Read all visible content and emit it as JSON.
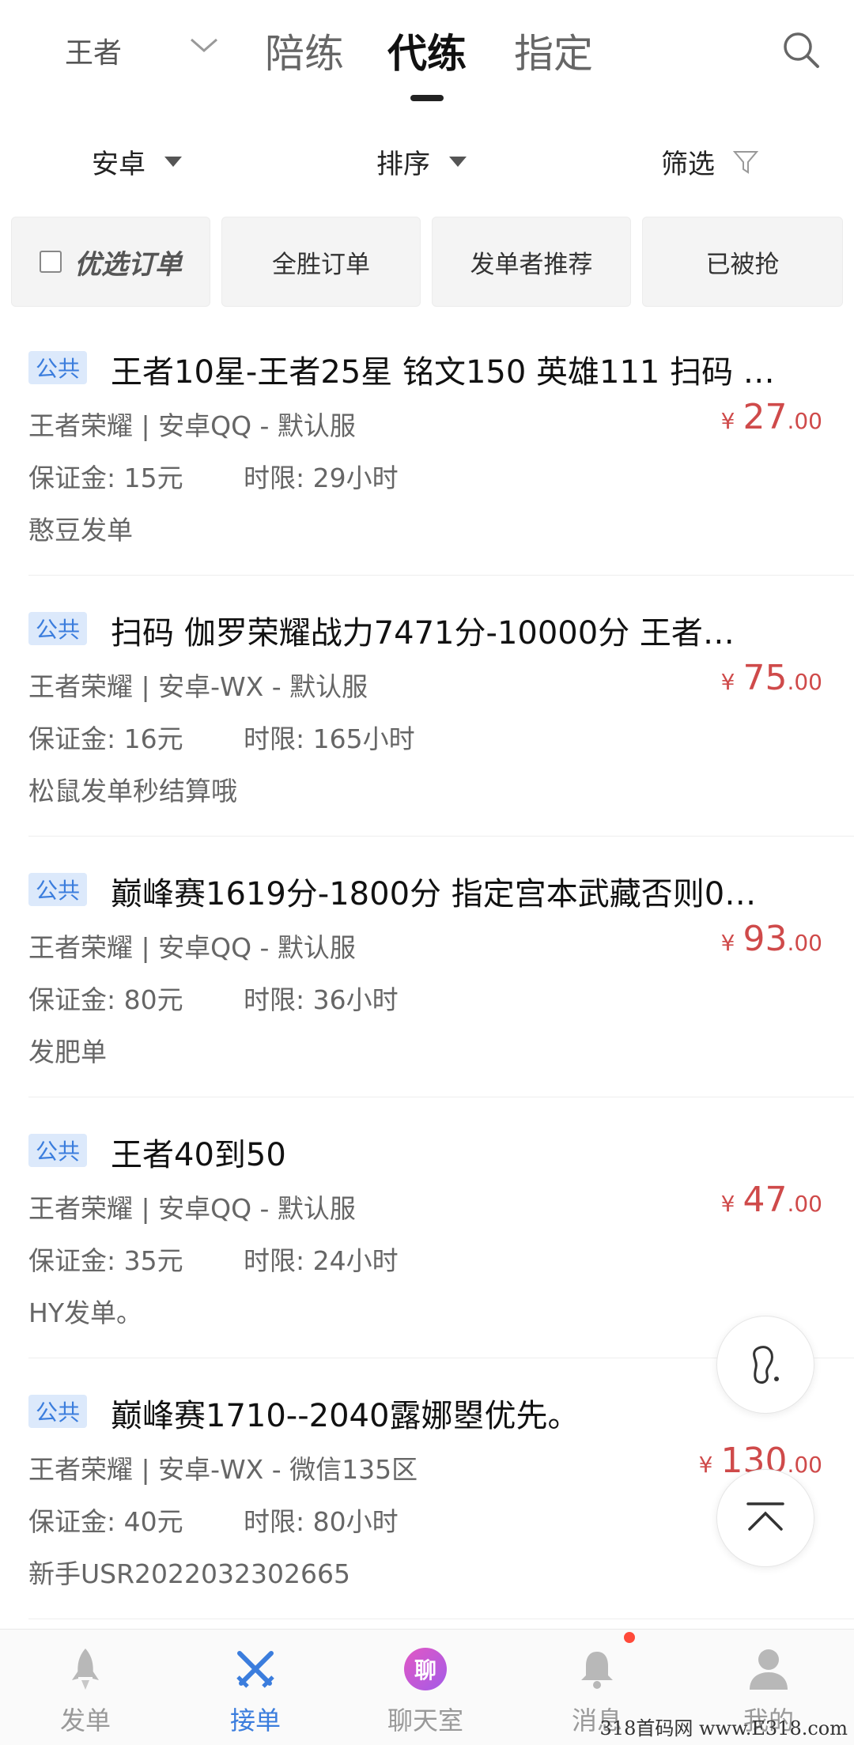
{
  "header": {
    "game": "王者",
    "tabs": [
      "陪练",
      "代练",
      "指定"
    ],
    "active_tab": 1
  },
  "filters": {
    "platform": "安卓",
    "sort": "排序",
    "filter": "筛选"
  },
  "chips": {
    "preferred": "优选订单",
    "all_win": "全胜订单",
    "recommended": "发单者推荐",
    "taken": "已被抢"
  },
  "orders": [
    {
      "badge": "公共",
      "title": "王者10星-王者25星 铭文150 英雄111 扫码 …",
      "meta": "王者荣耀 | 安卓QQ - 默认服",
      "deposit": "保证金: 15元",
      "time_limit": "时限:  29小时",
      "publisher": "憨豆发单",
      "price_symbol": "¥",
      "price_int": "27",
      "price_dec": ".00"
    },
    {
      "badge": "公共",
      "title": "扫码   伽罗荣耀战力7471分-10000分    王者…",
      "meta": "王者荣耀 | 安卓-WX - 默认服",
      "deposit": "保证金: 16元",
      "time_limit": "时限:  165小时",
      "publisher": "松鼠发单秒结算哦",
      "price_symbol": "¥",
      "price_int": "75",
      "price_dec": ".00"
    },
    {
      "badge": "公共",
      "title": "巅峰赛1619分-1800分 指定宫本武藏否则0…",
      "meta": "王者荣耀 | 安卓QQ - 默认服",
      "deposit": "保证金: 80元",
      "time_limit": "时限:  36小时",
      "publisher": "发肥单",
      "price_symbol": "¥",
      "price_int": "93",
      "price_dec": ".00"
    },
    {
      "badge": "公共",
      "title": "王者40到50",
      "meta": "王者荣耀 | 安卓QQ - 默认服",
      "deposit": "保证金: 35元",
      "time_limit": "时限:  24小时",
      "publisher": "HY发单。",
      "price_symbol": "¥",
      "price_int": "47",
      "price_dec": ".00"
    },
    {
      "badge": "公共",
      "title": "巅峰赛1710--2040露娜曌优先。",
      "meta": "王者荣耀 | 安卓-WX - 微信135区",
      "deposit": "保证金: 40元",
      "time_limit": "时限:  80小时",
      "publisher": "新手USR2022032302665",
      "price_symbol": "¥",
      "price_int": "130",
      "price_dec": ".00"
    }
  ],
  "nav": {
    "items": [
      "发单",
      "接单",
      "聊天室",
      "消息",
      "我的"
    ],
    "active": 1,
    "chat_badge": "聊"
  },
  "watermark": "318首码网  www.E318.com",
  "colors": {
    "accent": "#3b7ddd",
    "price": "#cf4a4a",
    "badge_bg": "#dce9fb"
  }
}
